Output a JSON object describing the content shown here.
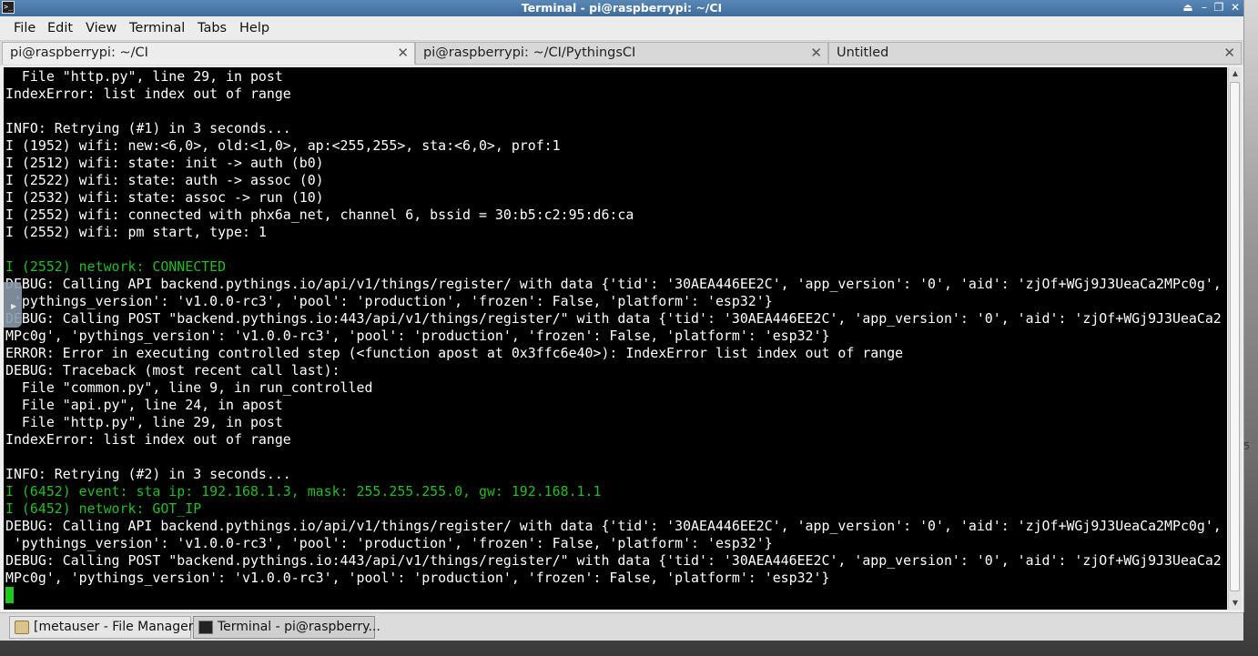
{
  "window": {
    "title": "Terminal - pi@raspberrypi: ~/CI"
  },
  "menu": [
    "File",
    "Edit",
    "View",
    "Terminal",
    "Tabs",
    "Help"
  ],
  "tabs": [
    {
      "label": "pi@raspberrypi: ~/CI",
      "active": true
    },
    {
      "label": "pi@raspberrypi: ~/CI/PythingsCI",
      "active": false
    },
    {
      "label": "Untitled",
      "active": false
    }
  ],
  "terminal": {
    "lines": [
      {
        "text": "  File \"http.py\", line 29, in post",
        "color": "#ffffff"
      },
      {
        "text": "IndexError: list index out of range",
        "color": "#ffffff"
      },
      {
        "text": "",
        "color": "#ffffff"
      },
      {
        "text": "INFO: Retrying (#1) in 3 seconds...",
        "color": "#ffffff"
      },
      {
        "text": "I (1952) wifi: new:<6,0>, old:<1,0>, ap:<255,255>, sta:<6,0>, prof:1",
        "color": "#ffffff"
      },
      {
        "text": "I (2512) wifi: state: init -> auth (b0)",
        "color": "#ffffff"
      },
      {
        "text": "I (2522) wifi: state: auth -> assoc (0)",
        "color": "#ffffff"
      },
      {
        "text": "I (2532) wifi: state: assoc -> run (10)",
        "color": "#ffffff"
      },
      {
        "text": "I (2552) wifi: connected with phx6a_net, channel 6, bssid = 30:b5:c2:95:d6:ca",
        "color": "#ffffff"
      },
      {
        "text": "I (2552) wifi: pm start, type: 1",
        "color": "#ffffff"
      },
      {
        "text": "",
        "color": "#ffffff"
      },
      {
        "text": "I (2552) network: CONNECTED",
        "color": "#1fbf1f"
      },
      {
        "text": "DEBUG: Calling API backend.pythings.io/api/v1/things/register/ with data {'tid': '30AEA446EE2C', 'app_version': '0', 'aid': 'zjOf+WGj9J3UeaCa2MPc0g',",
        "color": "#ffffff"
      },
      {
        "text": " 'pythings_version': 'v1.0.0-rc3', 'pool': 'production', 'frozen': False, 'platform': 'esp32'}",
        "color": "#ffffff"
      },
      {
        "text": "DEBUG: Calling POST \"backend.pythings.io:443/api/v1/things/register/\" with data {'tid': '30AEA446EE2C', 'app_version': '0', 'aid': 'zjOf+WGj9J3UeaCa2",
        "color": "#ffffff"
      },
      {
        "text": "MPc0g', 'pythings_version': 'v1.0.0-rc3', 'pool': 'production', 'frozen': False, 'platform': 'esp32'}",
        "color": "#ffffff"
      },
      {
        "text": "ERROR: Error in executing controlled step (<function apost at 0x3ffc6e40>): IndexError list index out of range",
        "color": "#ffffff"
      },
      {
        "text": "DEBUG: Traceback (most recent call last):",
        "color": "#ffffff"
      },
      {
        "text": "  File \"common.py\", line 9, in run_controlled",
        "color": "#ffffff"
      },
      {
        "text": "  File \"api.py\", line 24, in apost",
        "color": "#ffffff"
      },
      {
        "text": "  File \"http.py\", line 29, in post",
        "color": "#ffffff"
      },
      {
        "text": "IndexError: list index out of range",
        "color": "#ffffff"
      },
      {
        "text": "",
        "color": "#ffffff"
      },
      {
        "text": "INFO: Retrying (#2) in 3 seconds...",
        "color": "#ffffff"
      },
      {
        "text": "I (6452) event: sta ip: 192.168.1.3, mask: 255.255.255.0, gw: 192.168.1.1",
        "color": "#1fbf1f"
      },
      {
        "text": "I (6452) network: GOT_IP",
        "color": "#1fbf1f"
      },
      {
        "text": "DEBUG: Calling API backend.pythings.io/api/v1/things/register/ with data {'tid': '30AEA446EE2C', 'app_version': '0', 'aid': 'zjOf+WGj9J3UeaCa2MPc0g',",
        "color": "#ffffff"
      },
      {
        "text": " 'pythings_version': 'v1.0.0-rc3', 'pool': 'production', 'frozen': False, 'platform': 'esp32'}",
        "color": "#ffffff"
      },
      {
        "text": "DEBUG: Calling POST \"backend.pythings.io:443/api/v1/things/register/\" with data {'tid': '30AEA446EE2C', 'app_version': '0', 'aid': 'zjOf+WGj9J3UeaCa2",
        "color": "#ffffff"
      },
      {
        "text": "MPc0g', 'pythings_version': 'v1.0.0-rc3', 'pool': 'production', 'frozen': False, 'platform': 'esp32'}",
        "color": "#ffffff"
      }
    ],
    "cursor_color": "#1fc71f"
  },
  "taskbar": {
    "items": [
      {
        "label": "[metauser - File Manager]",
        "icon": "folder-icon",
        "active": false
      },
      {
        "label": "Terminal - pi@raspberry...",
        "icon": "terminal-icon",
        "active": true
      }
    ]
  },
  "desktop": {
    "edge_text": "5"
  }
}
